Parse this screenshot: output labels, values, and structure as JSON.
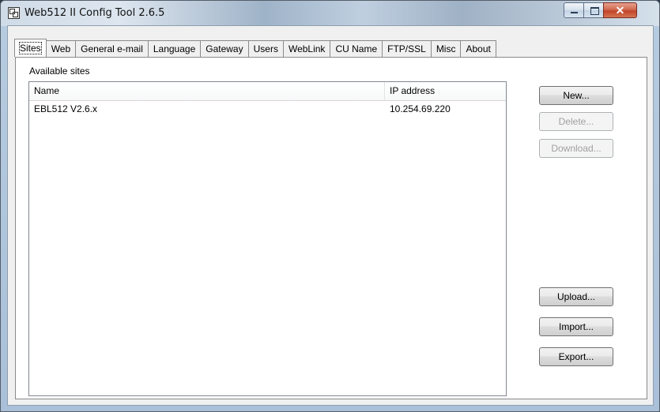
{
  "window": {
    "title": "Web512 II Config Tool 2.6.5",
    "controls": {
      "minimize": "",
      "maximize": "",
      "close": "✕"
    }
  },
  "tabs": [
    {
      "label": "Sites",
      "active": true
    },
    {
      "label": "Web"
    },
    {
      "label": "General e-mail"
    },
    {
      "label": "Language"
    },
    {
      "label": "Gateway"
    },
    {
      "label": "Users"
    },
    {
      "label": "WebLink"
    },
    {
      "label": "CU Name"
    },
    {
      "label": "FTP/SSL"
    },
    {
      "label": "Misc"
    },
    {
      "label": "About"
    }
  ],
  "sites": {
    "group_label": "Available sites",
    "columns": {
      "name": "Name",
      "ip": "IP address"
    },
    "rows": [
      {
        "name": "EBL512 V2.6.x",
        "ip": "10.254.69.220"
      }
    ]
  },
  "buttons": {
    "new": "New...",
    "delete": "Delete...",
    "download": "Download...",
    "upload": "Upload...",
    "import": "Import...",
    "export": "Export..."
  },
  "colors": {
    "titlebar": "#b6cbe0",
    "close": "#c2452a",
    "panel": "#ffffff"
  }
}
